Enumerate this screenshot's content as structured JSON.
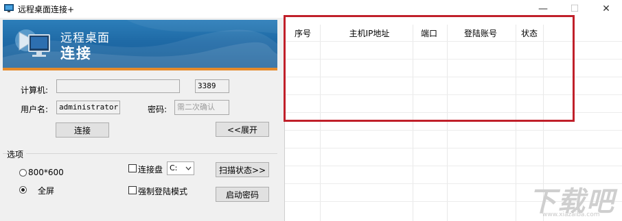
{
  "window": {
    "title": "远程桌面连接+",
    "minimize": "—",
    "maximize": "☐",
    "close": "✕"
  },
  "banner": {
    "line1": "远程桌面",
    "line2": "连接",
    "accent_color": "#e58a2b",
    "bg_color": "#1f6aa6"
  },
  "form": {
    "computer_label": "计算机:",
    "computer_value": "",
    "port_value": "3389",
    "username_label": "用户名:",
    "username_value": "administrator",
    "password_label": "密码:",
    "password_placeholder": "需二次确认",
    "connect_button": "连接",
    "expand_button": "<<展开"
  },
  "options": {
    "group_label": "选项",
    "res_800": "800*600",
    "fullscreen": "全屏",
    "selected_resolution": "全屏",
    "connect_disk_label": "连接盘",
    "connect_disk_checked": false,
    "drive_value": "C:",
    "force_login_label": "强制登陆模式",
    "force_login_checked": false,
    "scan_button": "扫描状态>>",
    "start_password_button": "启动密码"
  },
  "table": {
    "columns": [
      "序号",
      "主机IP地址",
      "端口",
      "登陆账号",
      "状态"
    ],
    "rows": []
  },
  "highlight_color": "#c0202a",
  "watermark": {
    "text": "下载吧",
    "url": "www.xiazaiba.com"
  }
}
